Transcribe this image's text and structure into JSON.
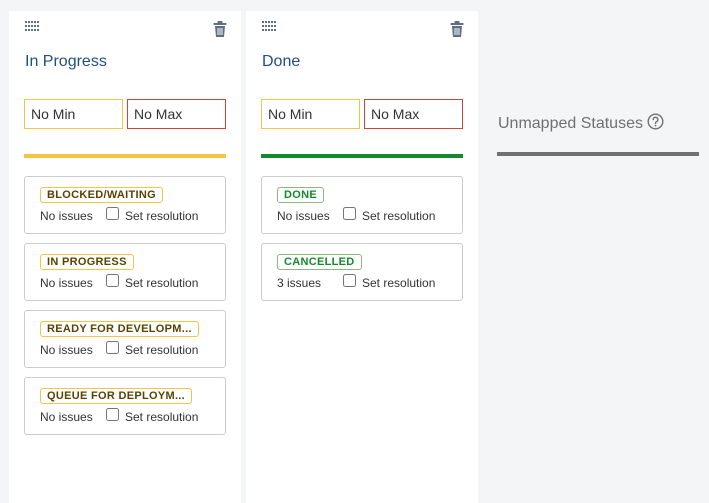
{
  "columns": [
    {
      "title": "In Progress",
      "min_placeholder": "No Min",
      "max_placeholder": "No Max",
      "line_color": "#f6c342",
      "statuses": [
        {
          "label": "BLOCKED/WAITING",
          "issues": "No issues",
          "resolution_label": "Set resolution",
          "tone": "yellow"
        },
        {
          "label": "IN PROGRESS",
          "issues": "No issues",
          "resolution_label": "Set resolution",
          "tone": "yellow"
        },
        {
          "label": "READY FOR DEVELOPM...",
          "issues": "No issues",
          "resolution_label": "Set resolution",
          "tone": "yellow"
        },
        {
          "label": "QUEUE FOR DEPLOYM...",
          "issues": "No issues",
          "resolution_label": "Set resolution",
          "tone": "yellow"
        }
      ]
    },
    {
      "title": "Done",
      "min_placeholder": "No Min",
      "max_placeholder": "No Max",
      "line_color": "#14892c",
      "statuses": [
        {
          "label": "DONE",
          "issues": "No issues",
          "resolution_label": "Set resolution",
          "tone": "green"
        },
        {
          "label": "CANCELLED",
          "issues": "3 issues",
          "resolution_label": "Set resolution",
          "tone": "green"
        }
      ]
    }
  ],
  "unmapped": {
    "title": "Unmapped Statuses",
    "help_icon": "question-circle-icon",
    "line_color": "#707070"
  },
  "icons": {
    "drag": "drag-handle-icon",
    "delete": "trash-icon"
  }
}
